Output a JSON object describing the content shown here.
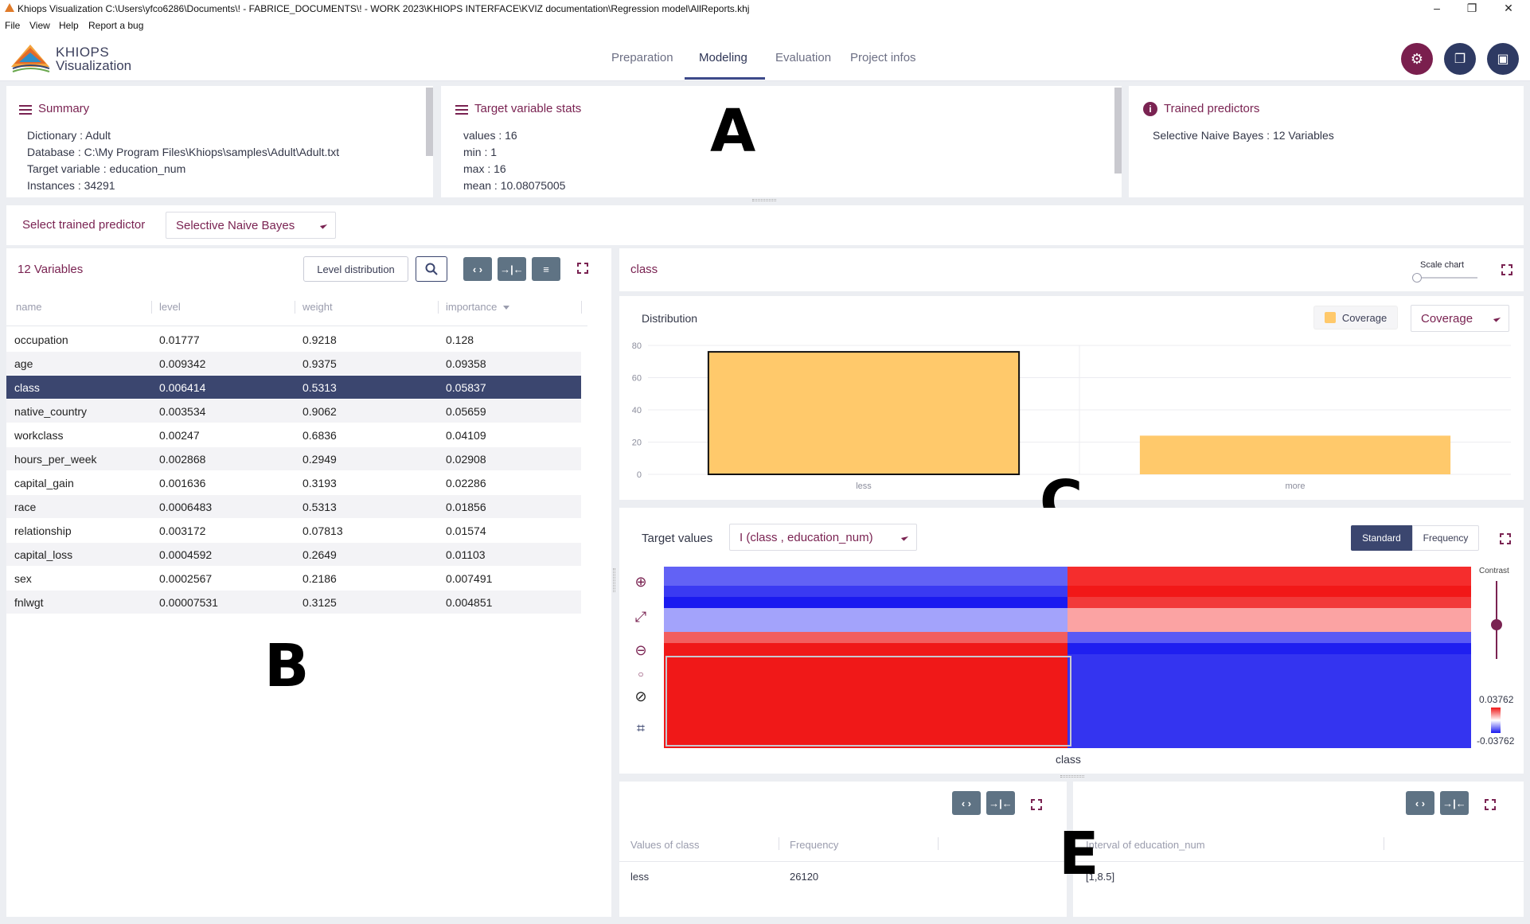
{
  "window": {
    "title": "Khiops Visualization C:\\Users\\yfco6286\\Documents\\! - FABRICE_DOCUMENTS\\! - WORK 2023\\KHIOPS INTERFACE\\KVIZ documentation\\Regression model\\AllReports.khj"
  },
  "menu": {
    "file": "File",
    "view": "View",
    "help": "Help",
    "report_bug": "Report a bug"
  },
  "logo": {
    "line1": "KHIOPS",
    "line2": "Visualization"
  },
  "nav": {
    "tabs": [
      {
        "label": "Preparation"
      },
      {
        "label": "Modeling"
      },
      {
        "label": "Evaluation"
      },
      {
        "label": "Project infos"
      }
    ],
    "active": "Modeling"
  },
  "summary": {
    "title": "Summary",
    "lines": [
      "Dictionary : Adult",
      "Database : C:\\My Program Files\\Khiops\\samples\\Adult\\Adult.txt",
      "Target variable : education_num",
      "Instances : 34291"
    ]
  },
  "target_stats": {
    "title": "Target variable stats",
    "lines": [
      "values : 16",
      "min : 1",
      "max : 16",
      "mean : 10.08075005"
    ]
  },
  "trained_predictors": {
    "title": "Trained predictors",
    "lines": [
      "Selective Naive Bayes : 12 Variables"
    ]
  },
  "labels": {
    "A": "A",
    "B": "B",
    "C": "C",
    "E": "E"
  },
  "predictor_select": {
    "label": "Select trained predictor",
    "value": "Selective Naive Bayes"
  },
  "variables": {
    "title": "12 Variables",
    "level_distribution_button": "Level distribution",
    "columns": [
      "name",
      "level",
      "weight",
      "importance"
    ],
    "rows": [
      [
        "occupation",
        "0.01777",
        "0.9218",
        "0.128"
      ],
      [
        "age",
        "0.009342",
        "0.9375",
        "0.09358"
      ],
      [
        "class",
        "0.006414",
        "0.5313",
        "0.05837"
      ],
      [
        "native_country",
        "0.003534",
        "0.9062",
        "0.05659"
      ],
      [
        "workclass",
        "0.00247",
        "0.6836",
        "0.04109"
      ],
      [
        "hours_per_week",
        "0.002868",
        "0.2949",
        "0.02908"
      ],
      [
        "capital_gain",
        "0.001636",
        "0.3193",
        "0.02286"
      ],
      [
        "race",
        "0.0006483",
        "0.5313",
        "0.01856"
      ],
      [
        "relationship",
        "0.003172",
        "0.07813",
        "0.01574"
      ],
      [
        "capital_loss",
        "0.0004592",
        "0.2649",
        "0.01103"
      ],
      [
        "sex",
        "0.0002567",
        "0.2186",
        "0.007491"
      ],
      [
        "fnlwgt",
        "0.00007531",
        "0.3125",
        "0.004851"
      ]
    ],
    "selected_index": 2
  },
  "distribution_panel": {
    "title": "class",
    "scale_label": "Scale chart",
    "subtitle": "Distribution",
    "legend_label": "Coverage",
    "select_value": "Coverage"
  },
  "chart_data": {
    "type": "bar",
    "categories": [
      "less",
      "more"
    ],
    "values": [
      76,
      24
    ],
    "ylim": [
      0,
      80
    ],
    "yticks": [
      "0",
      "20",
      "40",
      "60",
      "80"
    ],
    "series": [
      {
        "name": "Coverage",
        "values": [
          76,
          24
        ]
      }
    ],
    "color": "#ffc96b",
    "selected_index": 0
  },
  "heatmap": {
    "target_label": "Target values",
    "select_value": "I (class , education_num)",
    "standard_label": "Standard",
    "frequency_label": "Frequency",
    "contrast_label": "Contrast",
    "legend_max": "0.03762",
    "legend_min": "-0.03762",
    "xlabel": "class",
    "rows": [
      [
        "#6262f5",
        "#f52d2d"
      ],
      [
        "#3a3af2",
        "#f21818"
      ],
      [
        "#1a1af0",
        "#f23a3a"
      ],
      [
        "#a3a3fb",
        "#fba3a3"
      ],
      [
        "#f25e5e",
        "#5a5af5"
      ],
      [
        "#f01818",
        "#1f1ff0"
      ],
      [
        "#f01818",
        "#3434f0"
      ]
    ]
  },
  "values_table": {
    "columns": [
      "Values of class",
      "Frequency"
    ],
    "rows": [
      [
        "less",
        "26120"
      ]
    ]
  },
  "interval_table": {
    "columns": [
      "Interval of education_num"
    ],
    "rows": [
      [
        "[1,8.5]"
      ]
    ]
  },
  "colors": {
    "accent": "#7a2352",
    "navy": "#3b466f",
    "slate": "#5f7384"
  }
}
